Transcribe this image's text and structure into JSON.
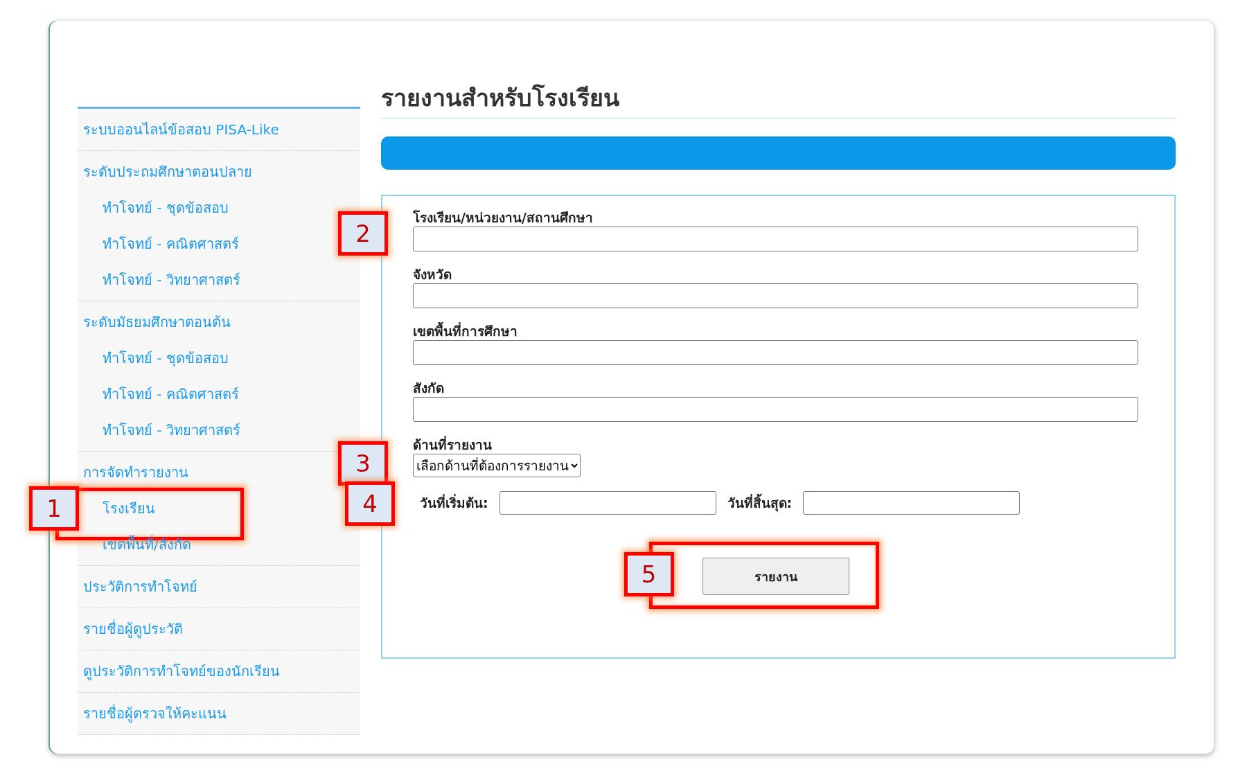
{
  "sidebar": {
    "items": [
      {
        "text": "ระบบออนไลน์ข้อสอบ PISA-Like"
      },
      {
        "text": "ระดับประถมศึกษาตอนปลาย",
        "children": [
          {
            "text": "ทำโจทย์ - ชุดข้อสอบ"
          },
          {
            "text": "ทำโจทย์ - คณิตศาสตร์"
          },
          {
            "text": "ทำโจทย์ - วิทยาศาสตร์"
          }
        ]
      },
      {
        "text": "ระดับมัธยมศึกษาตอนต้น",
        "children": [
          {
            "text": "ทำโจทย์ - ชุดข้อสอบ"
          },
          {
            "text": "ทำโจทย์ - คณิตศาสตร์"
          },
          {
            "text": "ทำโจทย์ - วิทยาศาสตร์"
          }
        ]
      },
      {
        "text": "การจัดทำรายงาน",
        "children": [
          {
            "text": "โรงเรียน",
            "callout": "1",
            "highlighted": true
          },
          {
            "text": "เขตพื้นที่/สังกัด"
          }
        ]
      },
      {
        "text": "ประวัติการทำโจทย์"
      },
      {
        "text": "รายชื่อผู้ดูประวัติ"
      },
      {
        "text": "ดูประวัติการทำโจทย์ของนักเรียน"
      },
      {
        "text": "รายชื่อผู้ตรวจให้คะแนน"
      }
    ]
  },
  "page_title": "รายงานสำหรับโรงเรียน",
  "form": {
    "fields": [
      {
        "label": "โรงเรียน/หน่วยงาน/สถานศึกษา",
        "callout": "2"
      },
      {
        "label": "จังหวัด"
      },
      {
        "label": "เขตพื้นที่การศึกษา"
      },
      {
        "label": "สังกัด"
      }
    ],
    "dropdown": {
      "label": "ด้านที่รายงาน",
      "value": "เลือกด้านที่ต้องการรายงาน",
      "callout": "3"
    },
    "date_range": {
      "start_label": "วันที่เริ่มต้น:",
      "end_label": "วันที่สิ้นสุด:",
      "callout": "4"
    },
    "button": {
      "label": "รายงาน",
      "callout": "5",
      "highlighted": true
    }
  }
}
